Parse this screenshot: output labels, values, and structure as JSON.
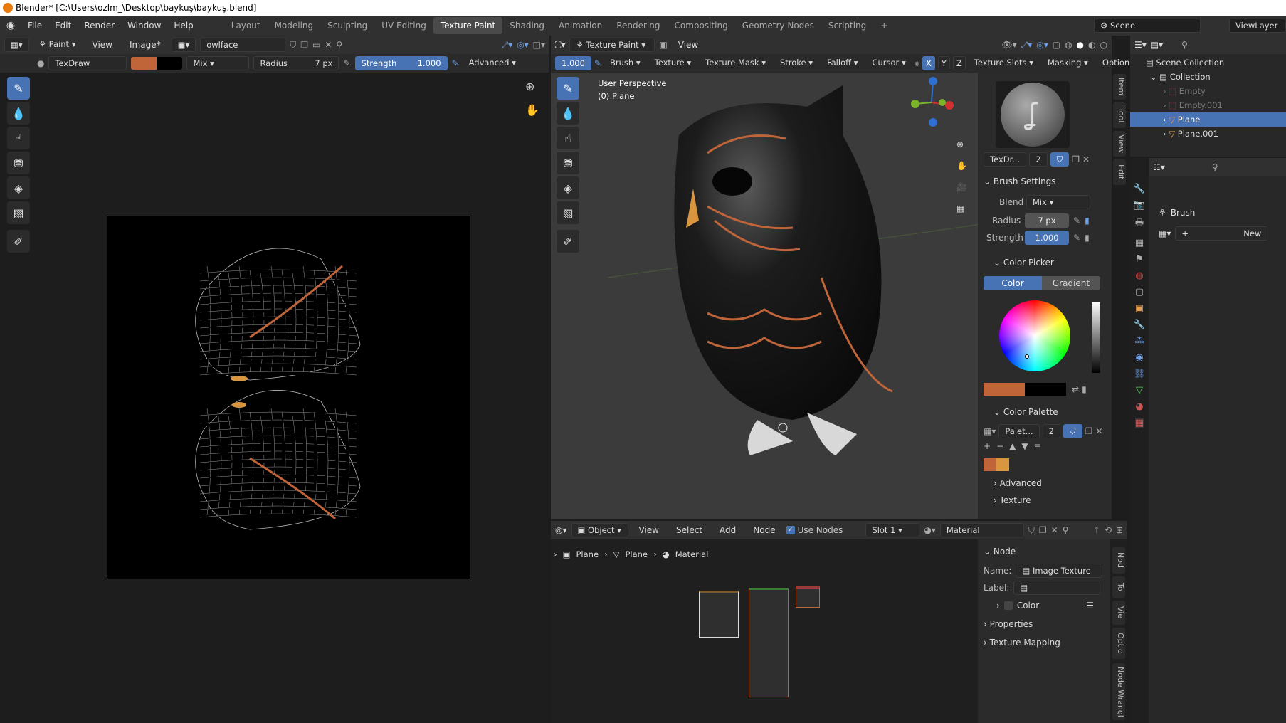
{
  "title": "Blender* [C:\\Users\\ozlm_\\Desktop\\baykuş\\baykuş.blend]",
  "menu": [
    "File",
    "Edit",
    "Render",
    "Window",
    "Help"
  ],
  "workspaces": [
    "Layout",
    "Modeling",
    "Sculpting",
    "UV Editing",
    "Texture Paint",
    "Shading",
    "Animation",
    "Rendering",
    "Compositing",
    "Geometry Nodes",
    "Scripting"
  ],
  "active_workspace": "Texture Paint",
  "scene": {
    "label": "Scene",
    "view_layer": "ViewLayer"
  },
  "image_editor": {
    "mode": "Paint",
    "view": "View",
    "image": "Image*",
    "image_name": "owlface",
    "brush": "TexDraw",
    "blend": "Mix",
    "radius_label": "Radius",
    "radius": "7 px",
    "strength_label": "Strength",
    "strength": "1.000",
    "advanced": "Advanced"
  },
  "viewport": {
    "mode": "Texture Paint",
    "view": "View",
    "value": "1.000",
    "menus": [
      "Brush",
      "Texture",
      "Texture Mask",
      "Stroke",
      "Falloff",
      "Cursor"
    ],
    "axes": [
      "X",
      "Y",
      "Z"
    ],
    "right_menus": [
      "Texture Slots",
      "Masking",
      "Options"
    ],
    "overlay_line1": "User Perspective",
    "overlay_line2": "(0) Plane"
  },
  "properties": {
    "brush_name": "TexDr...",
    "brush_users": "2",
    "brush_settings": "Brush Settings",
    "blend_label": "Blend",
    "blend": "Mix",
    "radius_label": "Radius",
    "radius": "7 px",
    "strength_label": "Strength",
    "strength": "1.000",
    "color_picker": "Color Picker",
    "tab_color": "Color",
    "tab_gradient": "Gradient",
    "color_palette": "Color Palette",
    "palette_name": "Palet...",
    "palette_users": "2",
    "advanced": "Advanced",
    "texture": "Texture",
    "tabs": [
      "Item",
      "Tool",
      "View",
      "Edit"
    ]
  },
  "colors": {
    "primary": "#c0643a",
    "secondary": "#000000",
    "swatch1": "#c0643a",
    "swatch2": "#d9963f",
    "accent": "#4772b3"
  },
  "node_editor": {
    "type": "Object",
    "view": "View",
    "select": "Select",
    "add": "Add",
    "node": "Node",
    "use_nodes": "Use Nodes",
    "slot": "Slot 1",
    "material": "Material",
    "breadcrumbs": [
      "Plane",
      "Plane",
      "Material"
    ],
    "panel_node": "Node",
    "name_label": "Name:",
    "name_value": "Image Texture",
    "label_label": "Label:",
    "color": "Color",
    "properties": "Properties",
    "texture_mapping": "Texture Mapping",
    "tabs": [
      "Nod",
      "To",
      "Vie",
      "Optio",
      "Node Wrangl"
    ]
  },
  "outliner": {
    "root": "Scene Collection",
    "collection": "Collection",
    "items": [
      "Empty",
      "Empty.001",
      "Plane",
      "Plane.001"
    ],
    "selected": "Plane"
  },
  "props_editor": {
    "brush": "Brush",
    "new": "New"
  }
}
